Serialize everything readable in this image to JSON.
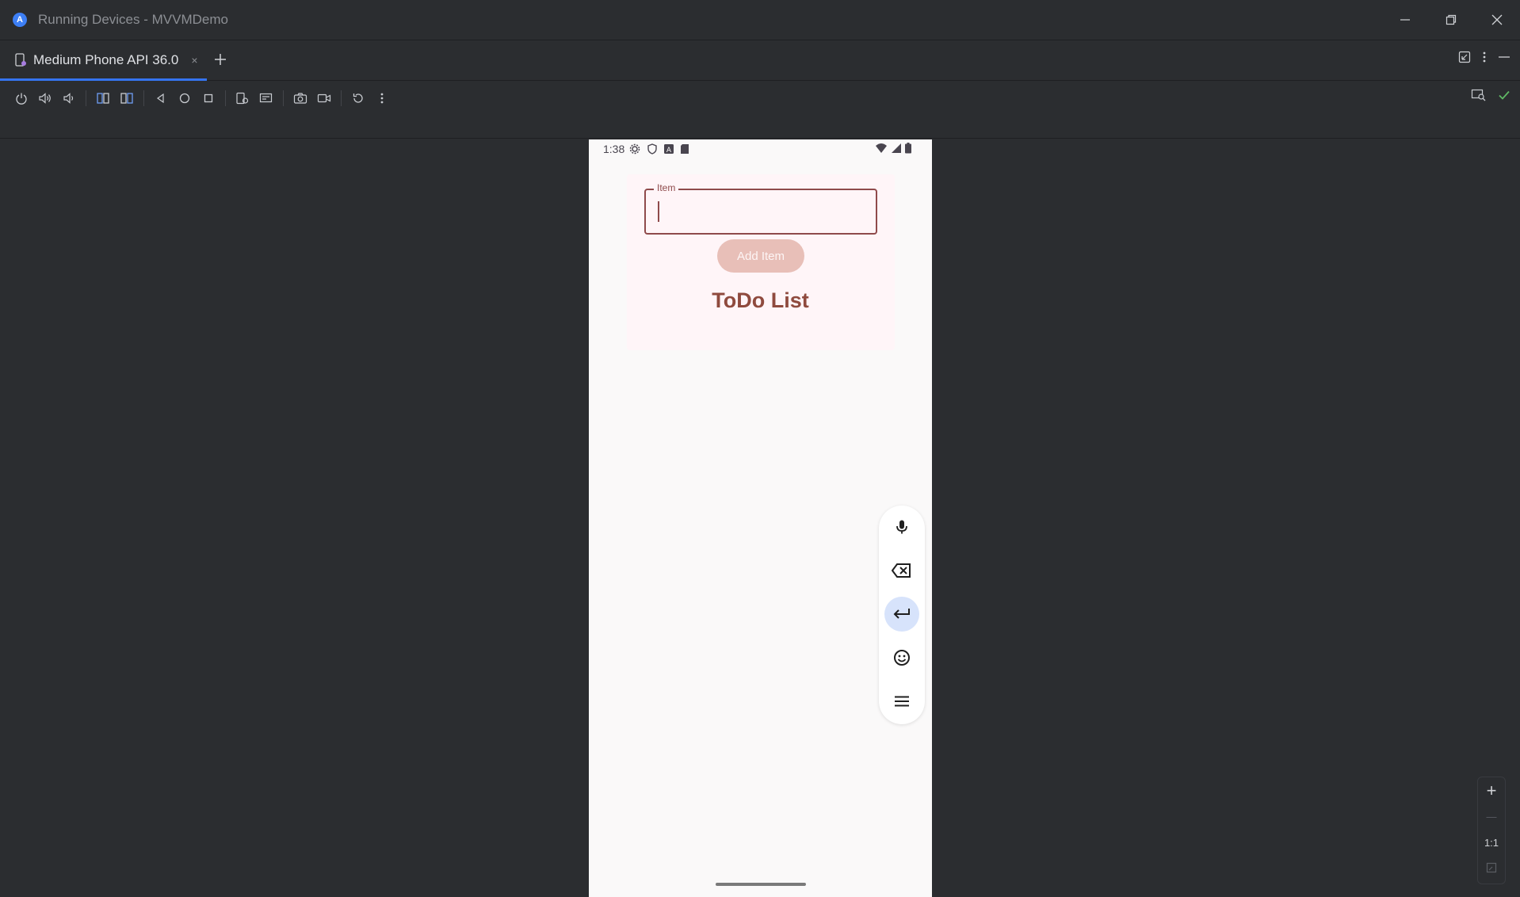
{
  "window": {
    "title": "Running Devices - MVVMDemo"
  },
  "tabs": {
    "items": [
      {
        "label": "Medium Phone API 36.0"
      }
    ],
    "close_glyph": "×",
    "add_glyph": "+"
  },
  "toolbar": {
    "left_icons": [
      "power-icon",
      "volume-up-icon",
      "volume-down-icon",
      "rotate-left-icon",
      "rotate-right-icon",
      "back-icon",
      "home-icon",
      "overview-icon",
      "device-settings-icon",
      "device-frame-icon",
      "screenshot-icon",
      "screen-record-icon",
      "reset-icon",
      "more-icon"
    ],
    "right_icons": [
      "screen-inspector-icon",
      "check-icon"
    ]
  },
  "phone": {
    "status_time": "1:38",
    "field_label": "Item",
    "field_value": "",
    "add_button_label": "Add Item",
    "list_title": "ToDo List",
    "keyboard_actions": [
      "mic-icon",
      "backspace-icon",
      "enter-icon",
      "emoji-icon",
      "menu-icon"
    ]
  },
  "zoom": {
    "plus": "+",
    "minus": "—",
    "one_to_one": "1:1"
  },
  "colors": {
    "accent": "#3574f0",
    "field_border": "#8f4a4b",
    "add_button_bg": "#e8bfb8",
    "todo_title": "#8f4a3e",
    "check": "#5fb865"
  }
}
